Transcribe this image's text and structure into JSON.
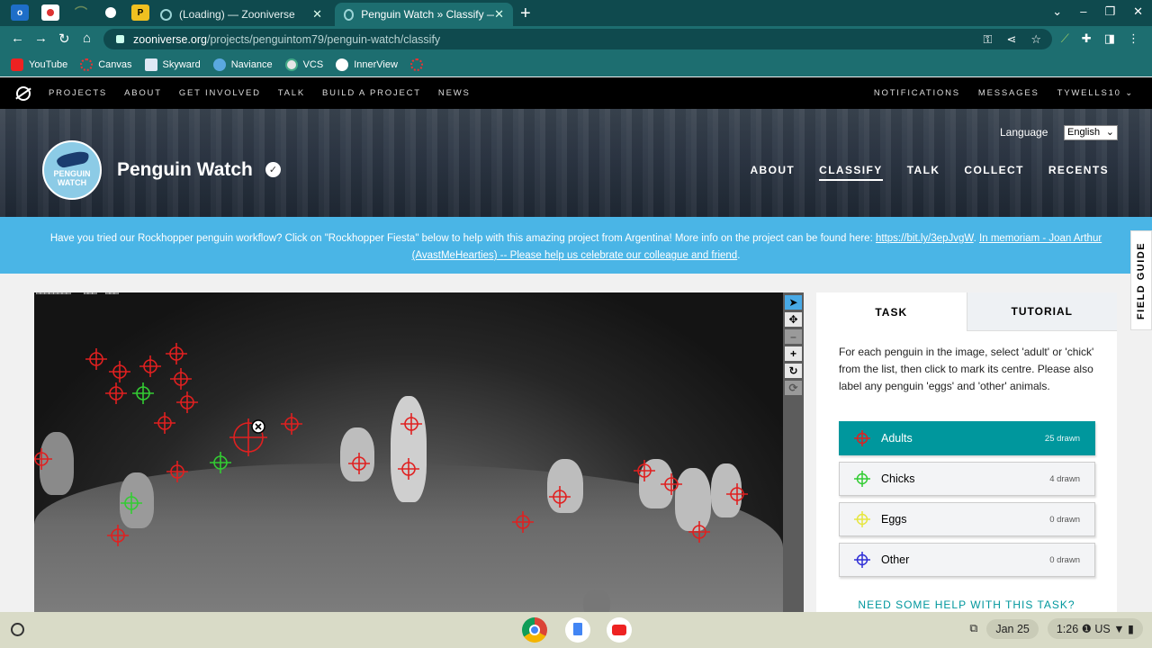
{
  "browser": {
    "tabs": [
      {
        "title": "(Loading) — Zooniverse"
      },
      {
        "title": "Penguin Watch » Classify — Zoon"
      }
    ],
    "url_host": "zooniverse.org",
    "url_path": "/projects/penguintom79/penguin-watch/classify",
    "bookmarks": [
      "YouTube",
      "Canvas",
      "Skyward",
      "Naviance",
      "VCS",
      "InnerView"
    ]
  },
  "zooniverse_nav": {
    "items": [
      "PROJECTS",
      "ABOUT",
      "GET INVOLVED",
      "TALK",
      "BUILD A PROJECT",
      "NEWS"
    ],
    "right": [
      "NOTIFICATIONS",
      "MESSAGES",
      "TYWELLS10"
    ]
  },
  "project": {
    "logo_text_1": "PENGUIN",
    "logo_text_2": "WATCH",
    "title": "Penguin Watch",
    "language_label": "Language",
    "language_value": "English",
    "nav": [
      "ABOUT",
      "CLASSIFY",
      "TALK",
      "COLLECT",
      "RECENTS"
    ]
  },
  "announcement": {
    "text_1": "Have you tried our Rockhopper penguin workflow? Click on \"Rockhopper Fiesta\" below to help with this amazing project from Argentina! More info on the project can be found here: ",
    "link_1": "https://bit.ly/3epJvgW",
    "text_2": ". ",
    "link_2": "In memoriam - Joan Arthur (AvastMeHearties) -- Please help us celebrate our colleague and friend",
    "text_3": "."
  },
  "field_guide": "FIELD GUIDE",
  "task": {
    "tabs": [
      "TASK",
      "TUTORIAL"
    ],
    "instructions": "For each penguin in the image, select 'adult' or 'chick' from the list, then click to mark its centre. Please also label any penguin 'eggs' and 'other' animals.",
    "options": [
      {
        "label": "Adults",
        "count": "25 drawn",
        "color": "#e02020"
      },
      {
        "label": "Chicks",
        "count": "4 drawn",
        "color": "#33cc33"
      },
      {
        "label": "Eggs",
        "count": "0 drawn",
        "color": "#e6e640"
      },
      {
        "label": "Other",
        "count": "0 drawn",
        "color": "#2f2fd6"
      }
    ],
    "help": "NEED SOME HELP WITH THIS TASK?"
  },
  "shelf": {
    "date": "Jan 25",
    "time": "1:26",
    "locale": "US"
  }
}
